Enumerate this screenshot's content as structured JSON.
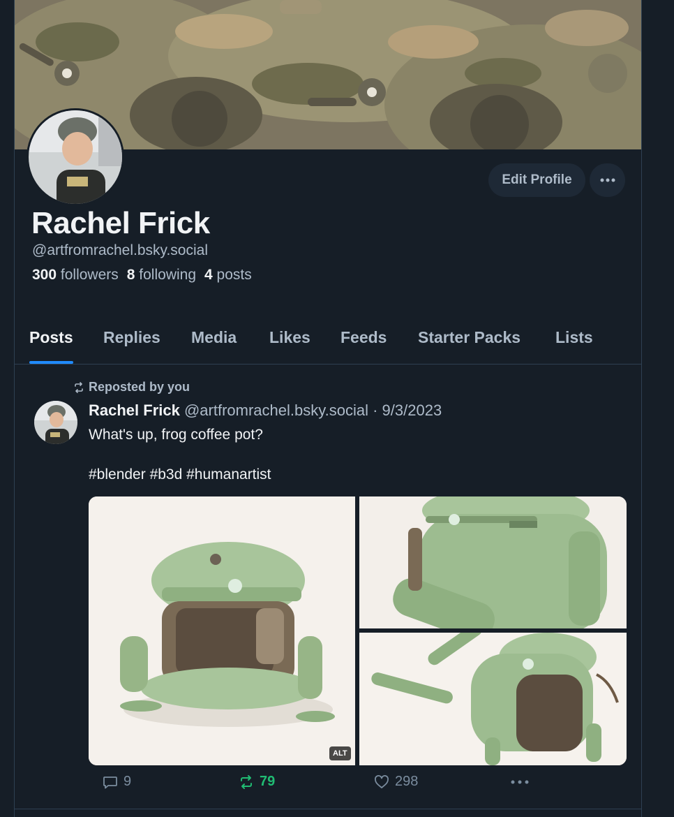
{
  "profile": {
    "display_name": "Rachel Frick",
    "handle": "@artfromrachel.bsky.social",
    "followers_count": "300",
    "followers_label": "followers",
    "following_count": "8",
    "following_label": "following",
    "posts_count": "4",
    "posts_label": "posts",
    "edit_button": "Edit Profile",
    "more_button": "•••"
  },
  "tabs": [
    {
      "label": "Posts",
      "active": true
    },
    {
      "label": "Replies"
    },
    {
      "label": "Media"
    },
    {
      "label": "Likes"
    },
    {
      "label": "Feeds"
    },
    {
      "label": "Starter Packs"
    },
    {
      "label": "Lists"
    }
  ],
  "post": {
    "repost_label": "Reposted by you",
    "author": "Rachel Frick",
    "handle": "@artfromrachel.bsky.social",
    "separator": "·",
    "date": "9/3/2023",
    "text": "What's up, frog coffee pot?",
    "tags": "#blender #b3d #humanartist",
    "alt_badge": "ALT",
    "replies": "9",
    "reposts": "79",
    "likes": "298",
    "more": "•••"
  },
  "colors": {
    "background": "#161e27",
    "accent": "#208bfe",
    "repost_active": "#20bc73",
    "muted_text": "#aebbc9"
  }
}
